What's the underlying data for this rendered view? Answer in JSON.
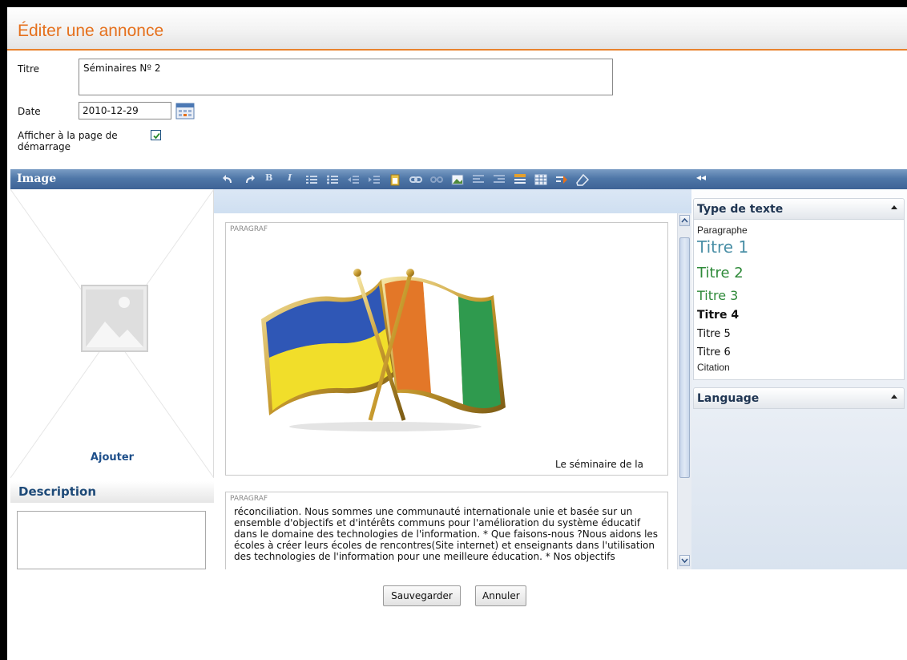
{
  "header": {
    "title": "Éditer une annonce"
  },
  "form": {
    "titre_label": "Titre",
    "titre_value": "Séminaires Nº 2",
    "date_label": "Date",
    "date_value": "2010-12-29",
    "afficher_label_1": "Afficher à la page de",
    "afficher_label_2": "démarrage",
    "afficher_checked": true
  },
  "image_panel": {
    "title": "Image",
    "add_label": "Ajouter"
  },
  "description_panel": {
    "title": "Description"
  },
  "editor": {
    "toolbar": [
      "undo-icon",
      "redo-icon",
      "bold-icon",
      "italic-icon",
      "ordered-list-icon",
      "unordered-list-icon",
      "outdent-icon",
      "indent-icon",
      "paste-icon",
      "link-icon",
      "unlink-icon",
      "image-icon",
      "align-left-icon",
      "align-right-icon",
      "block-icon",
      "table-icon",
      "wrap-icon",
      "eraser-icon"
    ],
    "bold_glyph": "B",
    "italic_glyph": "I",
    "block1_tag": "PARAGRAF",
    "block1_caption": "Le séminaire de la",
    "block2_tag": "PARAGRAF",
    "block2_text": "réconciliation. Nous sommes une communauté internationale unie et basée sur un ensemble d'objectifs et d'intérêts communs pour l'amélioration du système éducatif dans le domaine des technologies de l'information. * Que faisons-nous ?Nous aidons les écoles à créer leurs écoles de rencontres(Site internet) et enseignants dans l'utilisation des technologies de l'information pour une meilleure éducation. * Nos objectifs"
  },
  "right_panel": {
    "collapse_glyph": "◂◂",
    "type_texte_title": "Type de texte",
    "styles": [
      {
        "label": "Paragraphe",
        "color": "#111111"
      },
      {
        "label": "Titre 1",
        "color": "#4a8fa6"
      },
      {
        "label": "Titre 2",
        "color": "#2f8a3a"
      },
      {
        "label": "Titre 3",
        "color": "#2f8a3a"
      },
      {
        "label": "Titre 4",
        "color": "#111111"
      },
      {
        "label": "Titre 5",
        "color": "#111111"
      },
      {
        "label": "Titre 6",
        "color": "#111111"
      },
      {
        "label": "Citation",
        "color": "#111111"
      }
    ],
    "language_title": "Language"
  },
  "buttons": {
    "save": "Sauvegarder",
    "cancel": "Annuler"
  },
  "colors": {
    "accent": "#e5701c",
    "panel_blue": "#4f77a8",
    "link_blue": "#1e4f8a"
  }
}
